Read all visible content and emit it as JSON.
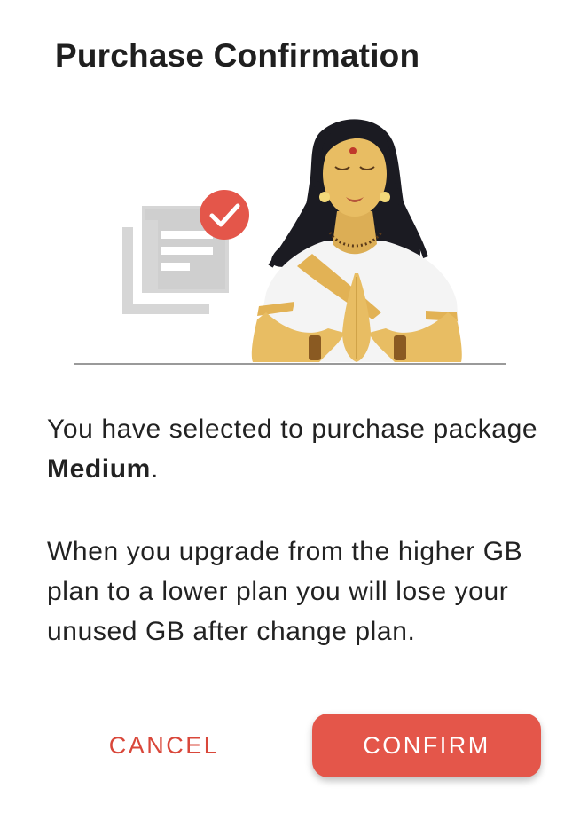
{
  "dialog": {
    "title": "Purchase Confirmation",
    "paragraph1": {
      "prefix": "You have selected to purchase package ",
      "package_name": "Medium",
      "suffix": "."
    },
    "paragraph2": "When you upgrade from the higher GB plan to a lower plan you will lose your unused GB after change plan.",
    "cancel_label": "CANCEL",
    "confirm_label": "CONFIRM"
  },
  "illustration": {
    "document_icon": "document-icon",
    "check_icon": "check-badge-icon",
    "figure": "greeting-woman-namaste"
  },
  "colors": {
    "accent": "#e4564a",
    "cancel_text": "#d9473a",
    "doc_gray": "#d6d6d6",
    "skin": "#e8bd63"
  }
}
